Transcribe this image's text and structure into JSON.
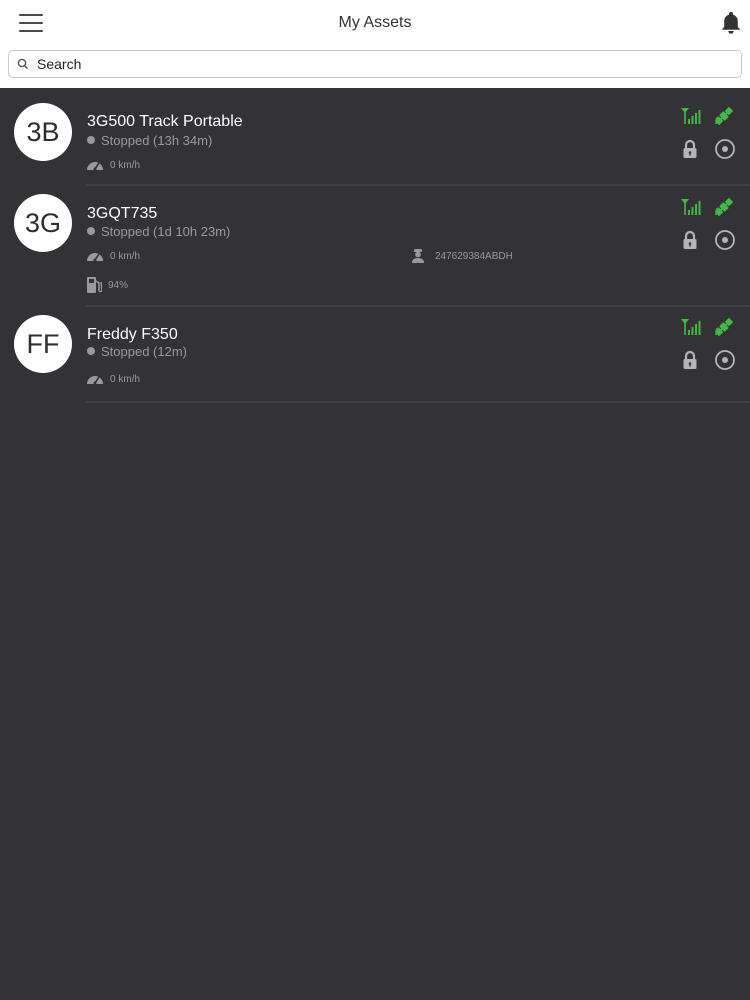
{
  "header": {
    "title": "My Assets"
  },
  "search": {
    "placeholder": "Search"
  },
  "colors": {
    "header_bg": "#ffffff",
    "list_bg": "#333234",
    "accent_green": "#46b64a",
    "muted_text": "#9a9a9a",
    "icon_gray": "#b5b5b5"
  },
  "icons": {
    "menu": "hamburger-menu-icon",
    "notifications": "bell-icon",
    "search": "search-icon",
    "signal": "signal-antenna-icon",
    "gps": "satellite-icon",
    "immobilizer": "lock-icon",
    "locate": "target-icon",
    "speed": "speedometer-icon",
    "driver": "driver-icon",
    "fuel": "fuel-pump-icon"
  },
  "assets": [
    {
      "initials": "3B",
      "name": "3G500 Track Portable",
      "status": "Stopped (13h 34m)",
      "speed": "0 km/h"
    },
    {
      "initials": "3G",
      "name": "3GQT735",
      "status": "Stopped (1d 10h 23m)",
      "speed": "0 km/h",
      "driver_id": "247629384ABDH",
      "fuel": "94%"
    },
    {
      "initials": "FF",
      "name": "Freddy F350",
      "status": "Stopped (12m)",
      "speed": "0 km/h"
    }
  ]
}
